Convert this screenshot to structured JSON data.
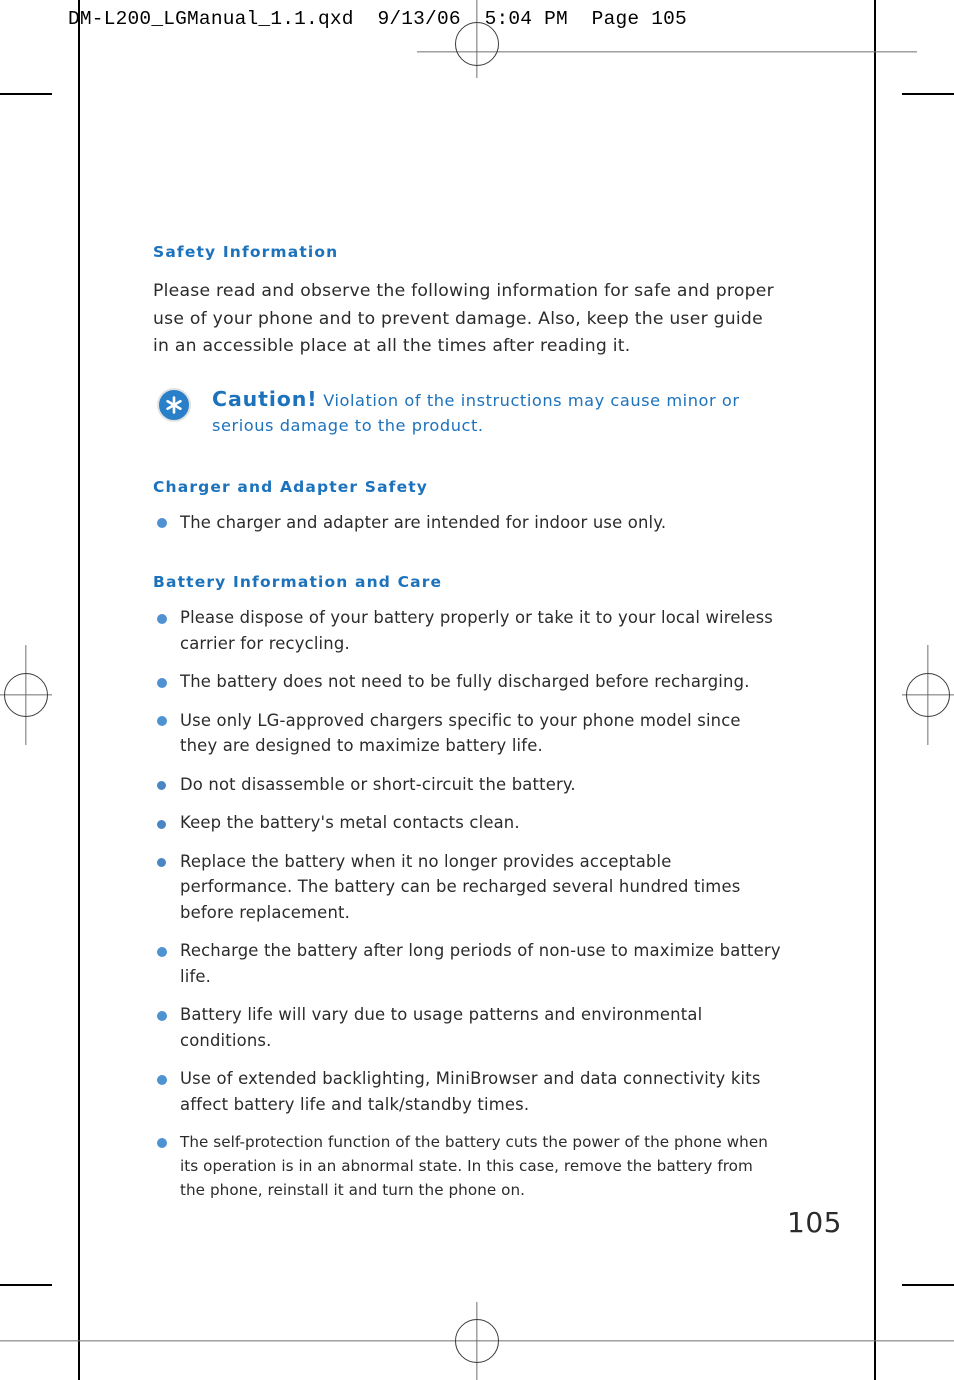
{
  "slug": {
    "text": "DM-L200_LGManual_1.1.qxd  9/13/06  5:04 PM  Page 105"
  },
  "folio": "105",
  "colors": {
    "heading_blue": "#1d72bc",
    "bullet_blue": "#4f92d4",
    "caution_icon_blue": "#2a7fc9",
    "body_text": "#2b2b2b"
  },
  "sections": {
    "safety": {
      "heading": "Safety Information",
      "intro": "Please read and observe the following information for safe and proper use of your phone and to prevent damage. Also, keep the user guide in an accessible place at all the times after reading it.",
      "caution": {
        "icon": "asterisk-icon",
        "word": "Caution!",
        "text": "Violation of the instructions may cause minor or serious damage to the product."
      }
    },
    "charger": {
      "heading": "Charger and Adapter Safety",
      "bullets": [
        "The charger and adapter are intended for indoor use only."
      ]
    },
    "battery": {
      "heading": "Battery Information and Care",
      "bullets": [
        "Please dispose of your battery properly or take it to your local wireless carrier for recycling.",
        "The battery does not need to be fully discharged before recharging.",
        "Use only LG-approved chargers specific to your phone model since they are designed to maximize battery life.",
        "Do not disassemble or short-circuit the battery.",
        "Keep the battery's metal contacts clean.",
        "Replace the battery when it no longer provides acceptable performance. The battery can be recharged several hundred times before replacement.",
        "Recharge the battery after long periods of non-use to maximize battery life.",
        "Battery life will vary due to usage patterns and environmental conditions.",
        "Use of extended backlighting, MiniBrowser and data connectivity kits affect battery life and talk/standby times.",
        "The self-protection function of the battery cuts the power of the phone when its operation is in an abnormal state. In this case, remove the battery from the phone, reinstall it and turn the phone on."
      ]
    }
  }
}
